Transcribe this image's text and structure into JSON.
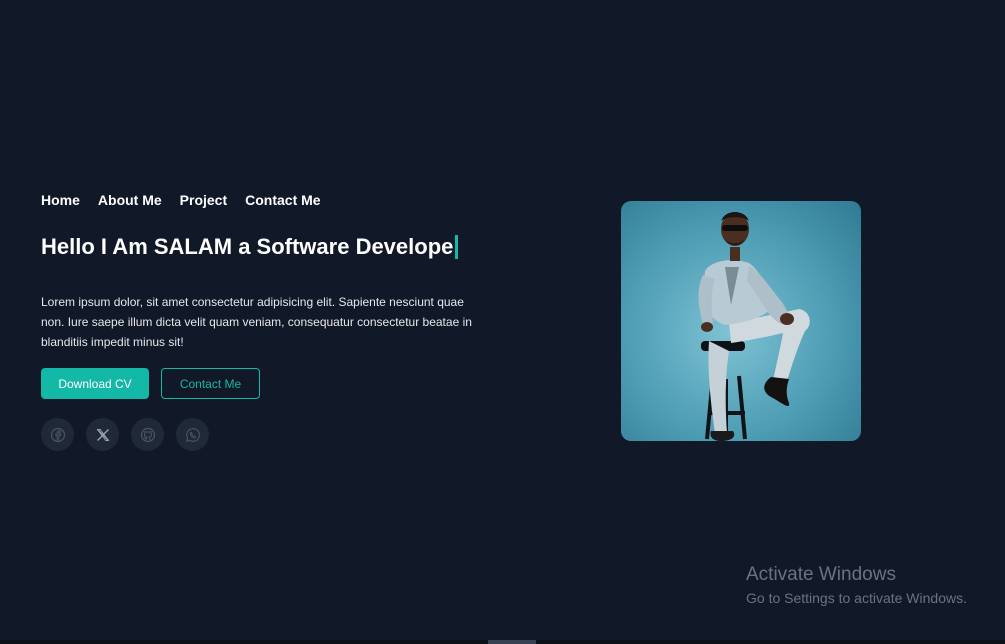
{
  "nav": {
    "items": [
      {
        "label": "Home"
      },
      {
        "label": "About Me"
      },
      {
        "label": "Project"
      },
      {
        "label": "Contact Me"
      }
    ]
  },
  "hero": {
    "title": "Hello I Am SALAM a Software Develope",
    "description": "Lorem ipsum dolor, sit amet consectetur adipisicing elit. Sapiente nesciunt quae non. Iure saepe illum dicta velit quam veniam, consequatur consectetur beatae in blanditiis impedit minus sit!"
  },
  "buttons": {
    "download": "Download CV",
    "contact": "Contact Me"
  },
  "socials": [
    {
      "icon": "facebook-icon"
    },
    {
      "icon": "x-icon"
    },
    {
      "icon": "github-icon"
    },
    {
      "icon": "whatsapp-icon"
    }
  ],
  "watermark": {
    "title": "Activate Windows",
    "subtitle": "Go to Settings to activate Windows."
  },
  "colors": {
    "background": "#111827",
    "accent": "#14b8a6",
    "social_bg": "#1f2937"
  }
}
